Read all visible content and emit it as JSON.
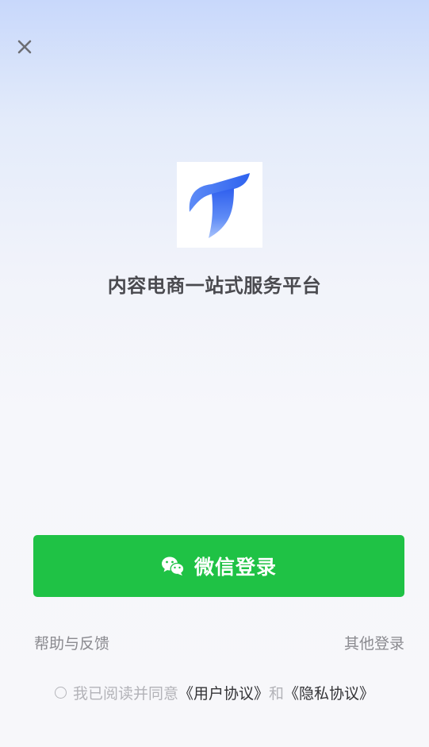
{
  "header": {
    "close_icon": "close-icon"
  },
  "brand": {
    "logo_icon": "app-logo-icon",
    "title": "内容电商一站式服务平台"
  },
  "login": {
    "wechat_icon": "wechat-icon",
    "wechat_label": "微信登录",
    "button_color": "#1fc245"
  },
  "links": {
    "help": "帮助与反馈",
    "other_login": "其他登录"
  },
  "agreement": {
    "checked": false,
    "prefix": "我已阅读并同意",
    "user_agreement": "《用户协议》",
    "connector": "和",
    "privacy_policy": "《隐私协议》"
  }
}
